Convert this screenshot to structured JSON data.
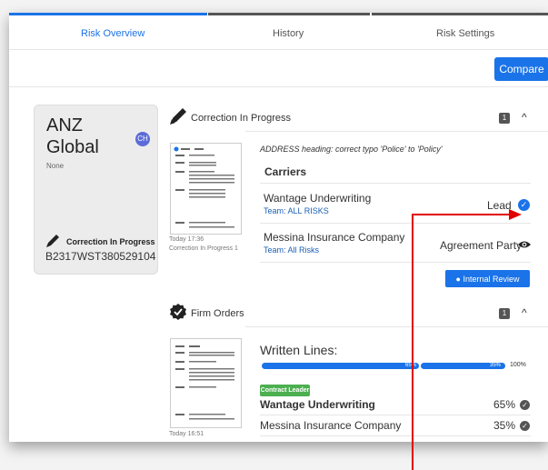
{
  "tabs": [
    {
      "label": "Risk Overview",
      "active": true
    },
    {
      "label": "History",
      "active": false
    },
    {
      "label": "Risk Settings",
      "active": false
    }
  ],
  "toolbar": {
    "compare_label": "Compare"
  },
  "risk_card": {
    "name_line1": "ANZ",
    "name_line2": "Global",
    "status": "None",
    "avatar_initials": "CH",
    "correction_status": "Correction In Progress",
    "reference": "B2317WST380529104"
  },
  "correction_section": {
    "title": "Correction In Progress",
    "count": "1",
    "thumb_time": "Today 17:36",
    "thumb_caption": "Correction In Progress 1",
    "note": "ADDRESS heading: correct typo 'Police' to 'Policy'",
    "carriers_heading": "Carriers",
    "carriers": [
      {
        "name": "Wantage Underwriting",
        "team": "Team: ALL RISKS",
        "role": "Lead"
      },
      {
        "name": "Messina Insurance Company",
        "team": "Team: All Risks",
        "role": "Agreement Party"
      }
    ],
    "internal_review_label": "Internal Review"
  },
  "firm_orders_section": {
    "title": "Firm Orders",
    "count": "1",
    "thumb_time": "Today 16:51",
    "written_lines_heading": "Written Lines:",
    "bar_left_label": "65%",
    "bar_right_label": "35%",
    "total_label": "100%",
    "bar_split_fraction": 0.65,
    "contract_leader_label": "Contract Leader",
    "lines": [
      {
        "name": "Wantage Underwriting",
        "pct": "65%",
        "bold": true
      },
      {
        "name": "Messina Insurance Company",
        "pct": "35%",
        "bold": false
      }
    ]
  },
  "colors": {
    "accent": "#1a73e8",
    "leader_green": "#4caf50",
    "annotation_red": "#e00000"
  }
}
